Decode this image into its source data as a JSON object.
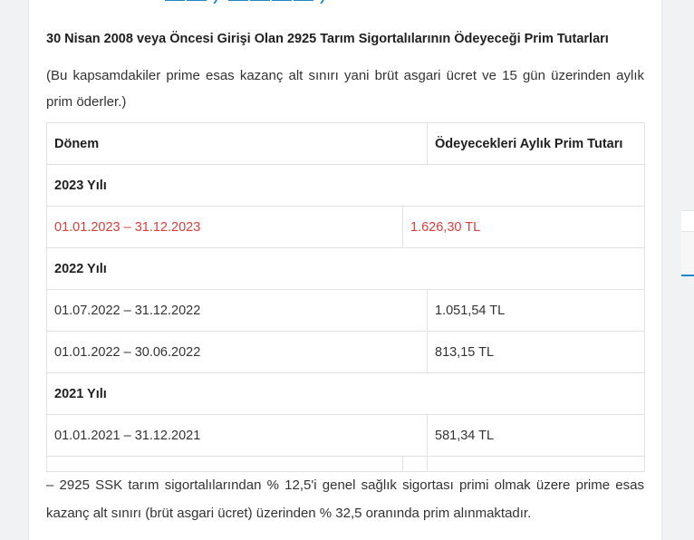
{
  "article": {
    "heading": "30 Nisan 2008 veya Öncesi Girişi Olan 2925 Tarım Sigortalılarının Ödeyeceği Prim Tutarları",
    "note": "(Bu kapsamdakiler prime esas kazanç alt sınırı yani brüt asgari ücret ve 15 gün üzerinden aylık prim öderler.)",
    "footer_note": "– 2925 SSK tarım sigortalılarından % 12,5'i genel sağlık sigortası primi olmak üzere prime esas kazanç alt sınırı (brüt asgari ücret) üzerinden % 32,5 oranında prim alınmaktadır."
  },
  "table": {
    "header": {
      "period": "Dönem",
      "amount": "Ödeyecekleri Aylık Prim Tutarı"
    },
    "sections": [
      {
        "year": "2023 Yılı",
        "rows": [
          {
            "period": "01.01.2023 – 31.12.2023",
            "amount": "1.626,30 TL"
          }
        ]
      },
      {
        "year": "2022 Yılı",
        "rows": [
          {
            "period": "01.07.2022 – 31.12.2022",
            "amount": "1.051,54 TL"
          },
          {
            "period": "01.01.2022 – 30.06.2022",
            "amount": "813,15 TL"
          }
        ]
      },
      {
        "year": "2021 Yılı",
        "rows": [
          {
            "period": "01.01.2021 – 31.12.2021",
            "amount": "581,34 TL"
          }
        ]
      }
    ]
  },
  "colors": {
    "accent": "#1e88c9",
    "highlight_row": "#e03b3b"
  }
}
